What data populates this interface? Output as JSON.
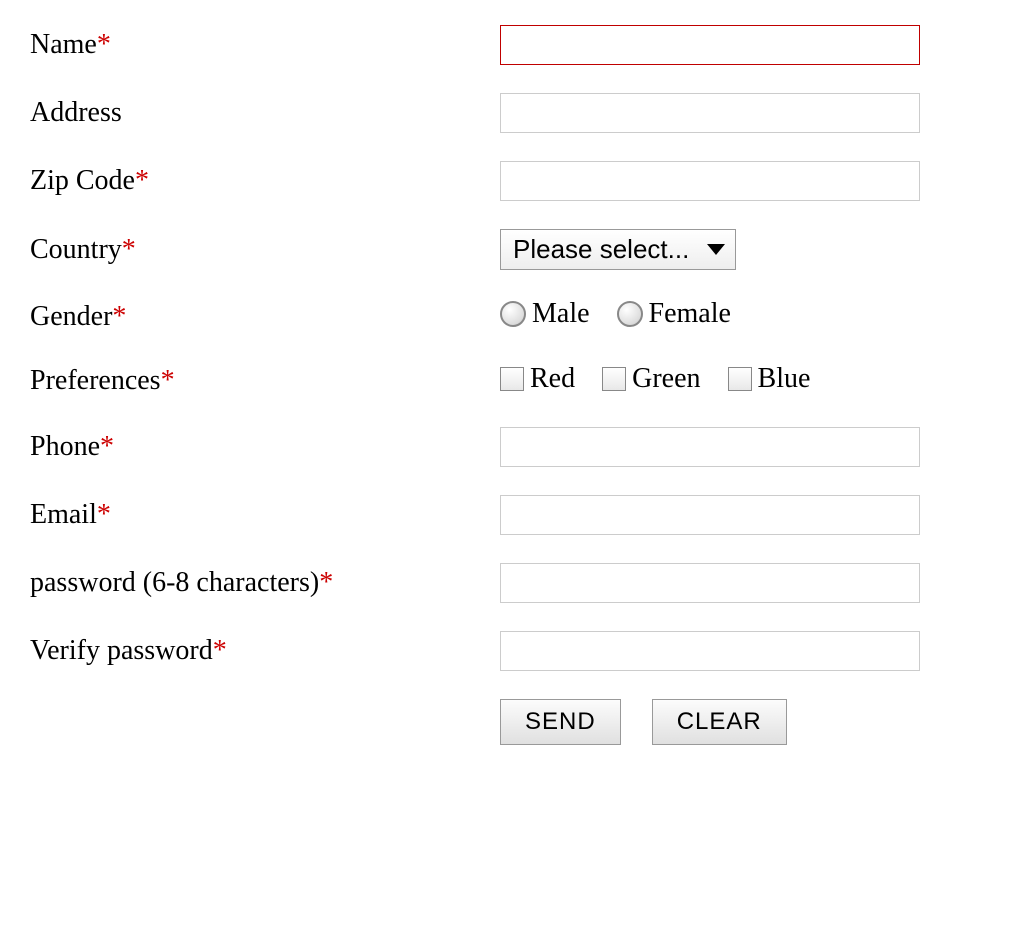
{
  "labels": {
    "name": "Name",
    "address": "Address",
    "zip": "Zip Code",
    "country": "Country",
    "gender": "Gender",
    "preferences": "Preferences",
    "phone": "Phone",
    "email": "Email",
    "password": "password (6-8 characters)",
    "verify": "Verify password"
  },
  "required_marker": "*",
  "values": {
    "name": "",
    "address": "",
    "zip": "",
    "phone": "",
    "email": "",
    "password": "",
    "verify": ""
  },
  "country": {
    "selected": "Please select..."
  },
  "gender": {
    "options": {
      "male": "Male",
      "female": "Female"
    }
  },
  "preferences": {
    "options": {
      "red": "Red",
      "green": "Green",
      "blue": "Blue"
    }
  },
  "buttons": {
    "send": "SEND",
    "clear": "CLEAR"
  }
}
